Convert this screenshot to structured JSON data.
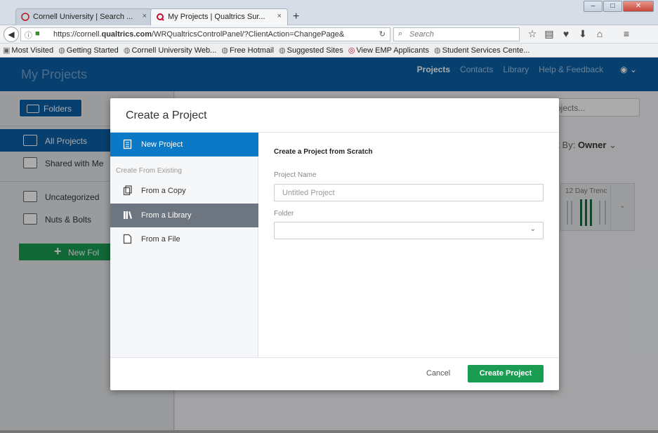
{
  "browser": {
    "tabs": [
      {
        "label": "Cornell University | Search ...",
        "close": "×",
        "favicon": "cornell-seal-icon"
      },
      {
        "label": "My Projects | Qualtrics Sur...",
        "close": "×",
        "favicon": "qualtrics-q-icon"
      }
    ],
    "new_tab": "+",
    "window_buttons": {
      "minimize": "–",
      "maximize": "□",
      "close": "✕"
    },
    "url_prefix": "https://cornell.",
    "url_domain": "qualtrics.com",
    "url_rest": "/WRQualtricsControlPanel/?ClientAction=ChangePage&",
    "search_placeholder": "Search",
    "bookmarks": [
      "Most Visited",
      "Getting Started",
      "Cornell University Web...",
      "Free Hotmail",
      "Suggested Sites",
      "View EMP Applicants",
      "Student Services Cente..."
    ]
  },
  "app": {
    "title": "My Projects",
    "nav": [
      "Projects",
      "Contacts",
      "Library",
      "Help & Feedback"
    ],
    "sidebar": {
      "folders_button": "Folders",
      "items": [
        "All Projects",
        "Shared with Me",
        "Uncategorized",
        "Nuts & Bolts"
      ],
      "new_folder": "New Fol"
    },
    "main": {
      "search_partial": "ojects...",
      "sort_prefix": "rt By:",
      "sort_value": "Owner",
      "trend_label": "12 Day Trenc"
    }
  },
  "modal": {
    "title": "Create a Project",
    "menu": {
      "new_project": "New Project",
      "section_heading": "Create From Existing",
      "from_copy": "From a Copy",
      "from_library": "From a Library",
      "from_file": "From a File"
    },
    "form": {
      "heading": "Create a Project from Scratch",
      "name_label": "Project Name",
      "name_placeholder": "Untitled Project",
      "folder_label": "Folder",
      "folder_value": ""
    },
    "cancel": "Cancel",
    "create": "Create Project"
  },
  "colors": {
    "brand_blue": "#0b5fa6",
    "active_blue": "#0b79c5",
    "green": "#1a9c52",
    "hover_gray": "#6d7581"
  }
}
